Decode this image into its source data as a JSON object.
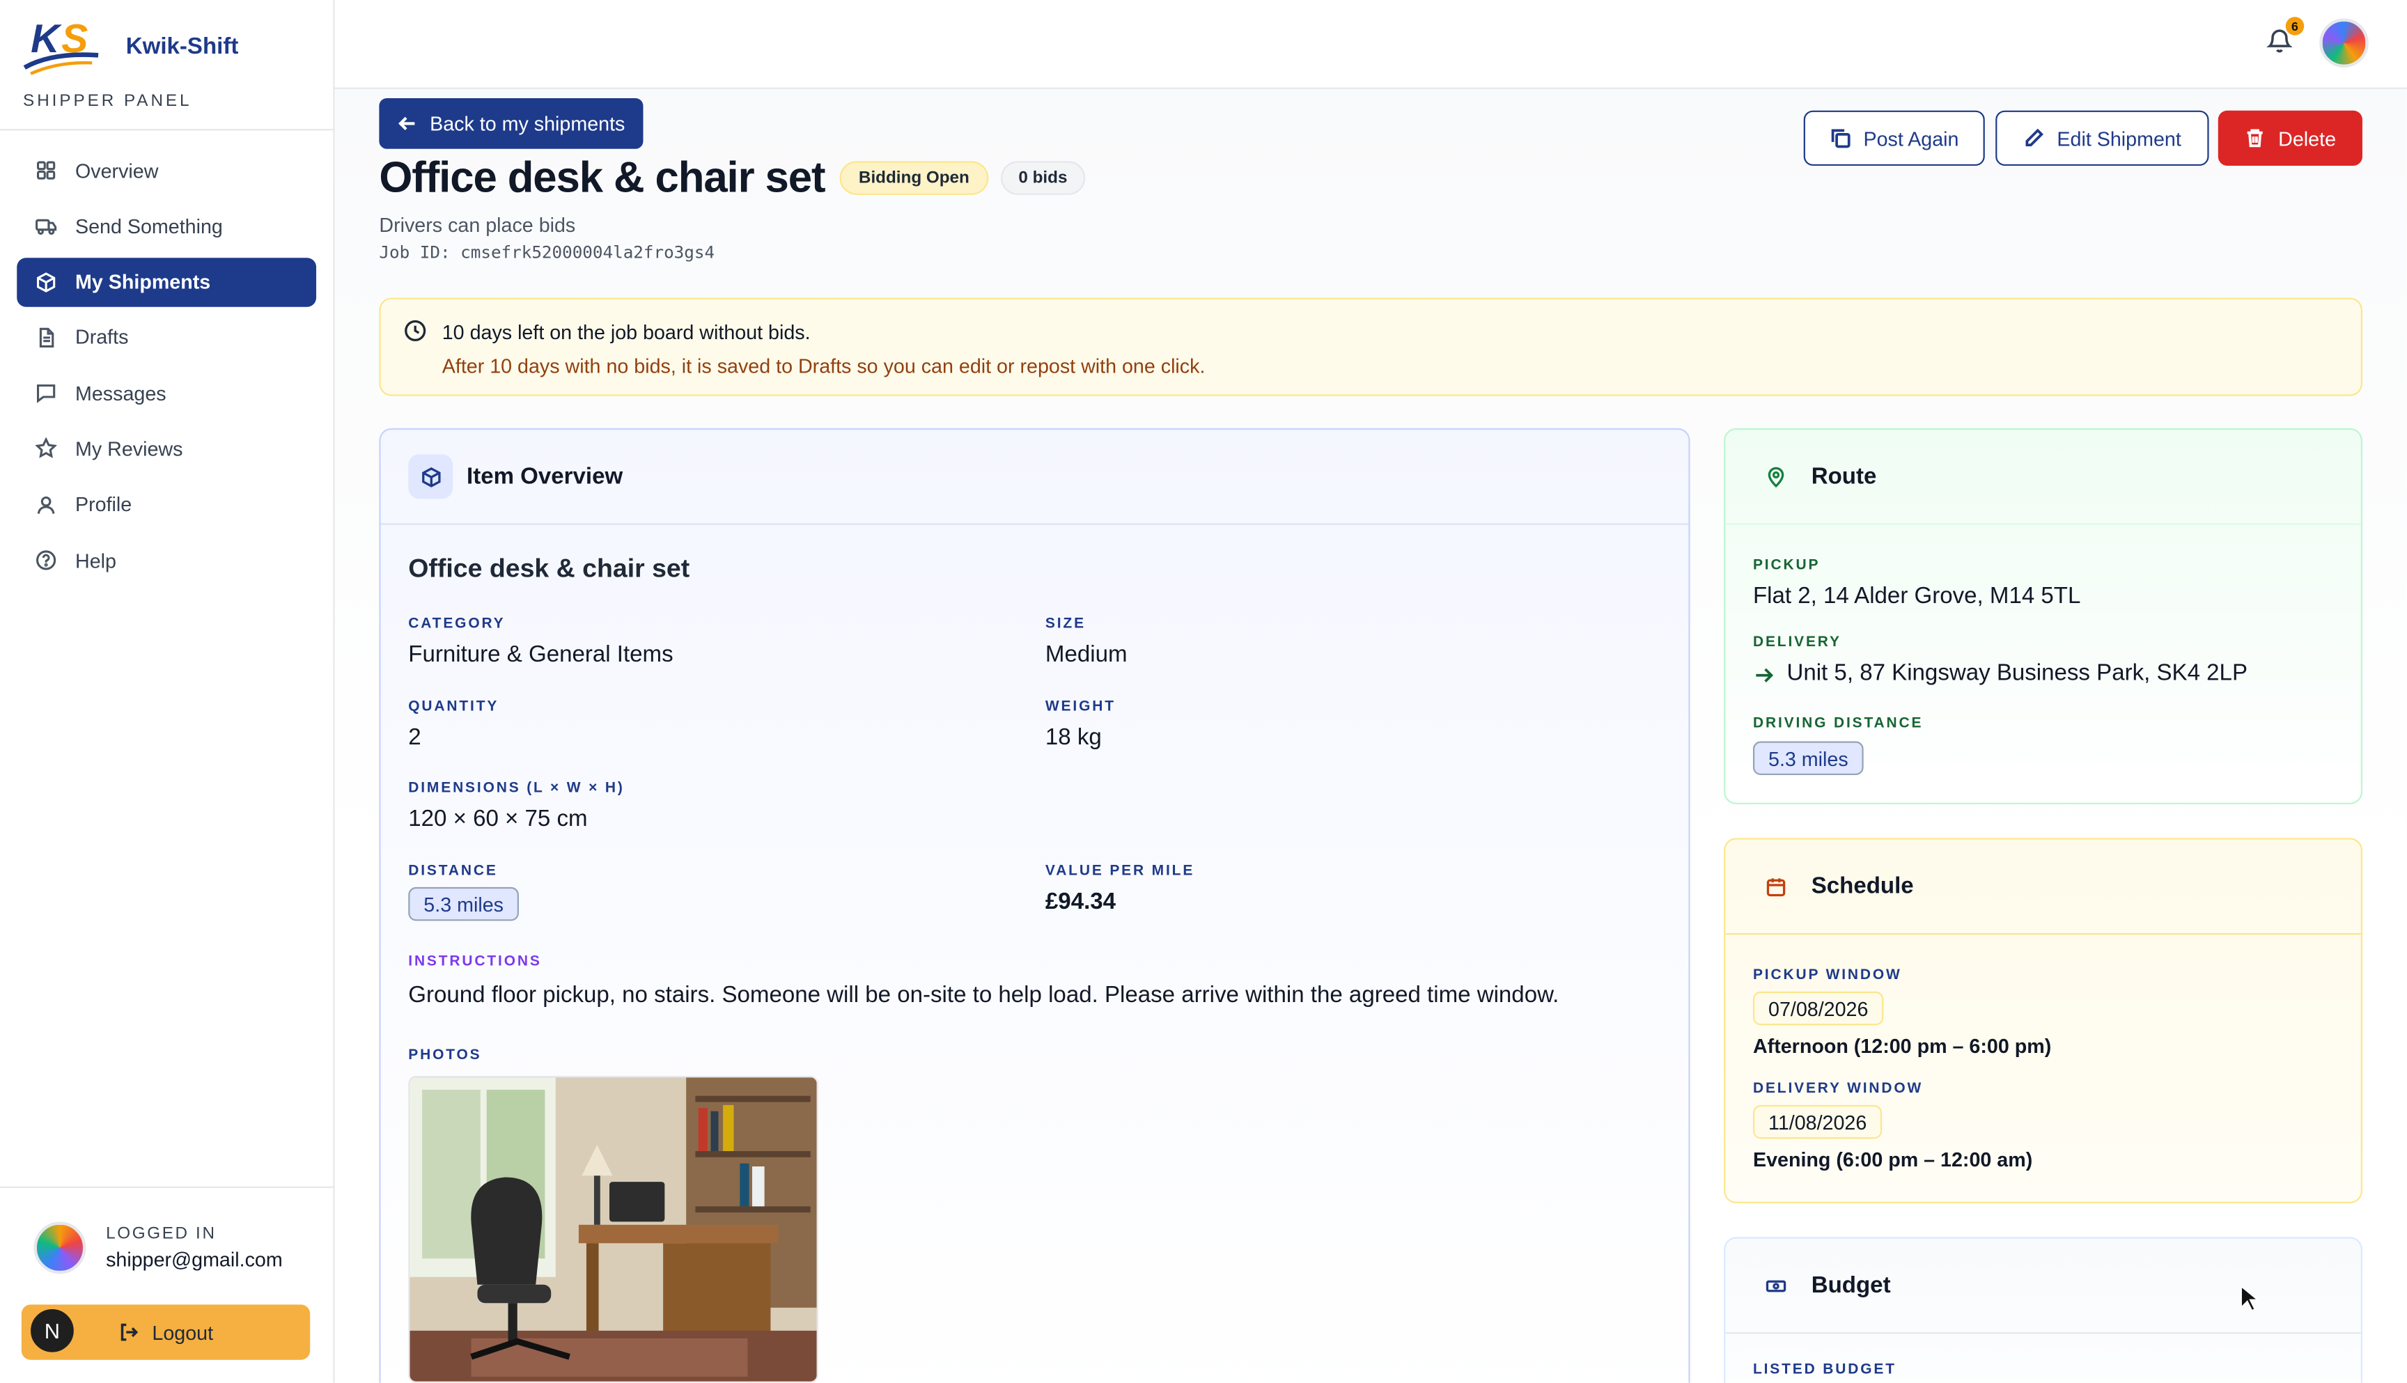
{
  "app": {
    "brand_name": "Kwik-Shift",
    "panel_label": "SHIPPER PANEL",
    "notification_count": "6"
  },
  "sidebar": {
    "items": [
      {
        "label": "Overview",
        "icon": "grid-icon"
      },
      {
        "label": "Send Something",
        "icon": "truck-icon"
      },
      {
        "label": "My Shipments",
        "icon": "package-icon",
        "active": true
      },
      {
        "label": "Drafts",
        "icon": "file-icon"
      },
      {
        "label": "Messages",
        "icon": "message-icon"
      },
      {
        "label": "My Reviews",
        "icon": "star-icon"
      },
      {
        "label": "Profile",
        "icon": "user-icon"
      },
      {
        "label": "Help",
        "icon": "help-icon"
      }
    ],
    "user_caption": "LOGGED IN",
    "user_email": "shipper@gmail.com",
    "logout_label": "Logout",
    "avatar_initial": "N"
  },
  "header": {
    "back_label": "Back to my shipments",
    "title": "Office desk & chair set",
    "status_badge": "Bidding Open",
    "bids_badge": "0 bids",
    "subtitle": "Drivers can place bids",
    "job_id": "Job ID: cmsefrk52000004la2fro3gs4",
    "actions": {
      "post_again": "Post Again",
      "edit": "Edit Shipment",
      "delete": "Delete"
    }
  },
  "notice": {
    "title": "10 days left on the job board without bids.",
    "text": "After 10 days with no bids, it is saved to Drafts so you can edit or repost with one click."
  },
  "overview": {
    "card_title": "Item Overview",
    "item_name": "Office desk & chair set",
    "category_label": "CATEGORY",
    "category": "Furniture & General Items",
    "size_label": "SIZE",
    "size": "Medium",
    "quantity_label": "QUANTITY",
    "quantity": "2",
    "weight_label": "WEIGHT",
    "weight": "18 kg",
    "dimensions_label": "DIMENSIONS (L × W × H)",
    "dimensions": "120 × 60 × 75 cm",
    "distance_label": "DISTANCE",
    "distance": "5.3 miles",
    "value_per_mile_label": "VALUE PER MILE",
    "value_per_mile": "£94.34",
    "instructions_label": "INSTRUCTIONS",
    "instructions": "Ground floor pickup, no stairs. Someone will be on-site to help load. Please arrive within the agreed time window.",
    "photos_label": "PHOTOS"
  },
  "route": {
    "card_title": "Route",
    "pickup_label": "PICKUP",
    "pickup": "Flat 2, 14 Alder Grove, M14 5TL",
    "delivery_label": "DELIVERY",
    "delivery": "Unit 5, 87 Kingsway Business Park, SK4 2LP",
    "distance_label": "DRIVING DISTANCE",
    "distance": "5.3 miles"
  },
  "schedule": {
    "card_title": "Schedule",
    "pickup_label": "PICKUP WINDOW",
    "pickup_date": "07/08/2026",
    "pickup_time": "Afternoon (12:00 pm – 6:00 pm)",
    "delivery_label": "DELIVERY WINDOW",
    "delivery_date": "11/08/2026",
    "delivery_time": "Evening (6:00 pm – 12:00 am)"
  },
  "budget": {
    "card_title": "Budget",
    "listed_label": "LISTED BUDGET"
  },
  "colors": {
    "primary": "#1e3a8a",
    "accent": "#f5b041",
    "danger": "#dc2626"
  }
}
